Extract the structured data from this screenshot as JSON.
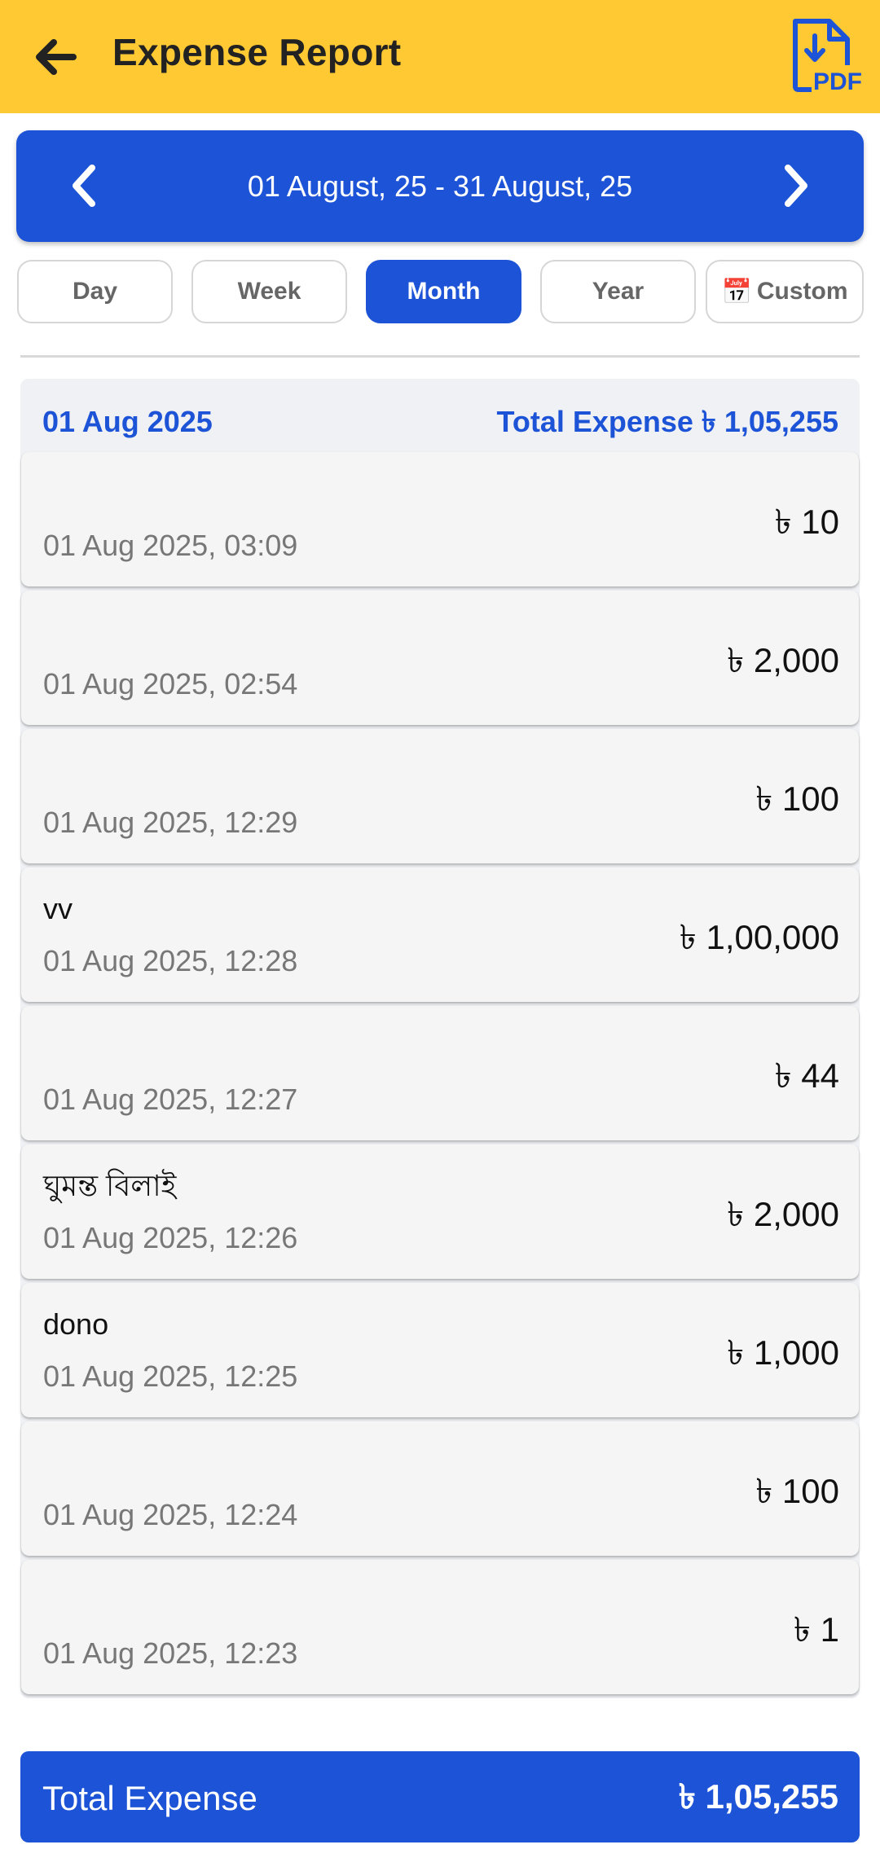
{
  "header": {
    "title": "Expense Report",
    "back_icon": "arrow-left-icon",
    "pdf_icon": "pdf-download-icon",
    "background": "#ffc933"
  },
  "range": {
    "label": "01 August, 25 - 31 August, 25",
    "prev_icon": "chevron-left-icon",
    "next_icon": "chevron-right-icon",
    "color": "#1d53d6"
  },
  "tabs": [
    {
      "label": "Day"
    },
    {
      "label": "Week"
    },
    {
      "label": "Month",
      "active": true
    },
    {
      "label": "Year"
    },
    {
      "label": "Custom",
      "icon": "calendar-icon"
    }
  ],
  "group": {
    "date": "01 Aug 2025",
    "total": "Total Expense ৳ 1,05,255",
    "entries": [
      {
        "note": "",
        "time": "01 Aug 2025, 03:09",
        "amount": "৳ 10"
      },
      {
        "note": "",
        "time": "01 Aug 2025, 02:54",
        "amount": "৳ 2,000"
      },
      {
        "note": "",
        "time": "01 Aug 2025, 12:29",
        "amount": "৳ 100"
      },
      {
        "note": "vv",
        "time": "01 Aug 2025, 12:28",
        "amount": "৳ 1,00,000"
      },
      {
        "note": "",
        "time": "01 Aug 2025, 12:27",
        "amount": "৳ 44"
      },
      {
        "note": "ঘুমন্ত বিলাই",
        "time": "01 Aug 2025, 12:26",
        "amount": "৳ 2,000"
      },
      {
        "note": "dono",
        "time": "01 Aug 2025, 12:25",
        "amount": "৳ 1,000"
      },
      {
        "note": "",
        "time": "01 Aug 2025, 12:24",
        "amount": "৳ 100"
      },
      {
        "note": "",
        "time": "01 Aug 2025, 12:23",
        "amount": "৳ 1"
      }
    ]
  },
  "footer": {
    "label": "Total Expense",
    "value": "৳ 1,05,255"
  }
}
